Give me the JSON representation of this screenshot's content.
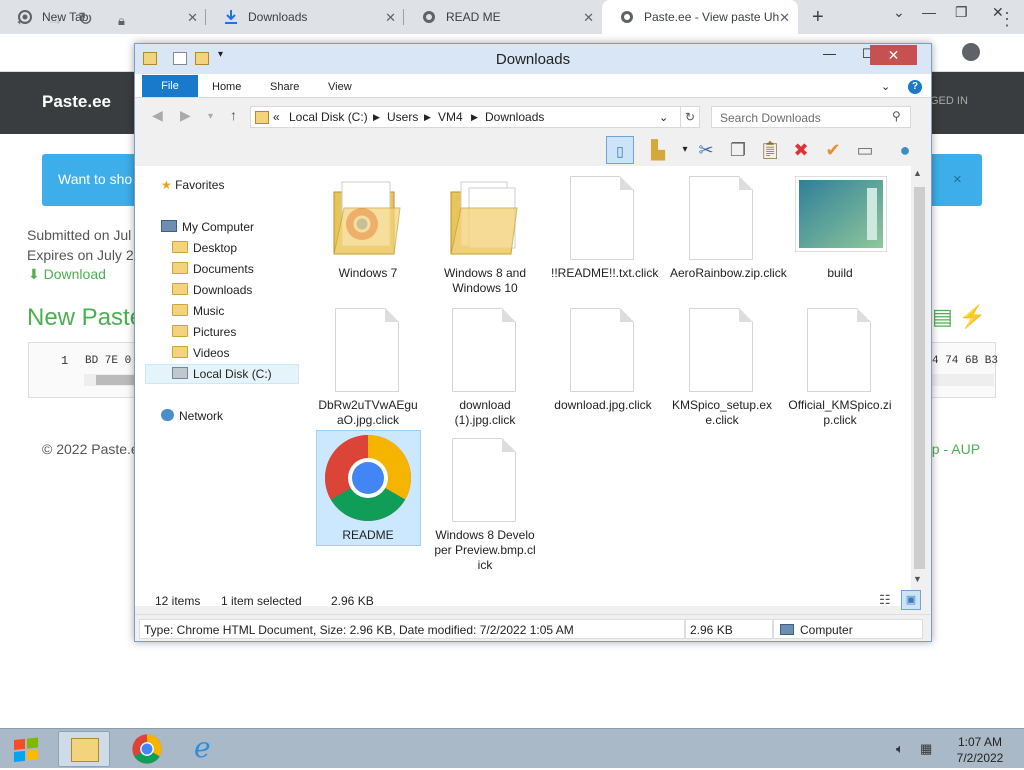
{
  "browser": {
    "tabs": [
      {
        "title": "New Tab",
        "icon": "chrome-icon"
      },
      {
        "title": "Downloads",
        "icon": "download-icon"
      },
      {
        "title": "READ ME",
        "icon": "globe-icon"
      },
      {
        "title": "Paste.ee - View paste Uh",
        "icon": "globe-icon",
        "active": true
      }
    ],
    "new_tab_symbol": "+"
  },
  "page": {
    "brand": "Paste.ee",
    "logged_in": "GED IN",
    "banner_text": "Want to sho",
    "banner_close": "×",
    "submitted": "Submitted on Jul",
    "expires": "Expires on July 2,",
    "download": "Download",
    "title": "New Paste",
    "line_number": "1",
    "code_start": "BD 7E 0",
    "code_end": "4 74 6B B3",
    "footer_left": "© 2022 Paste.e",
    "footer_right": "op - AUP"
  },
  "explorer": {
    "title": "Downloads",
    "ribbon": {
      "file": "File",
      "home": "Home",
      "share": "Share",
      "view": "View",
      "help": "?"
    },
    "address": {
      "prefix": "«",
      "parts": [
        "Local Disk (C:)",
        "Users",
        "VM4",
        "Downloads"
      ]
    },
    "search_placeholder": "Search Downloads",
    "nav": {
      "favorites": "Favorites",
      "my_computer": "My Computer",
      "desktop": "Desktop",
      "documents": "Documents",
      "downloads": "Downloads",
      "music": "Music",
      "pictures": "Pictures",
      "videos": "Videos",
      "local_disk": "Local Disk (C:)",
      "network": "Network"
    },
    "items": [
      {
        "name": "Windows 7",
        "type": "folder-chrome"
      },
      {
        "name": "Windows 8 and Windows 10",
        "type": "folder"
      },
      {
        "name": "!!README!!.txt.click",
        "type": "file"
      },
      {
        "name": "AeroRainbow.zip.click",
        "type": "file"
      },
      {
        "name": "build",
        "type": "image"
      },
      {
        "name": "DbRw2uTVwAEguaO.jpg.click",
        "type": "file"
      },
      {
        "name": "download (1).jpg.click",
        "type": "file"
      },
      {
        "name": "download.jpg.click",
        "type": "file"
      },
      {
        "name": "KMSpico_setup.exe.click",
        "type": "file"
      },
      {
        "name": "Official_KMSpico.zip.click",
        "type": "file"
      },
      {
        "name": "README",
        "type": "chrome",
        "selected": true
      },
      {
        "name": "Windows 8 Developer Preview.bmp.click",
        "type": "file"
      }
    ],
    "status": {
      "count": "12 items",
      "selected": "1 item selected",
      "size": "2.96 KB"
    },
    "details": {
      "info": "Type: Chrome HTML Document, Size: 2.96 KB, Date modified: 7/2/2022 1:05 AM",
      "size": "2.96 KB",
      "location": "Computer"
    }
  },
  "taskbar": {
    "time": "1:07 AM",
    "date": "7/2/2022"
  }
}
